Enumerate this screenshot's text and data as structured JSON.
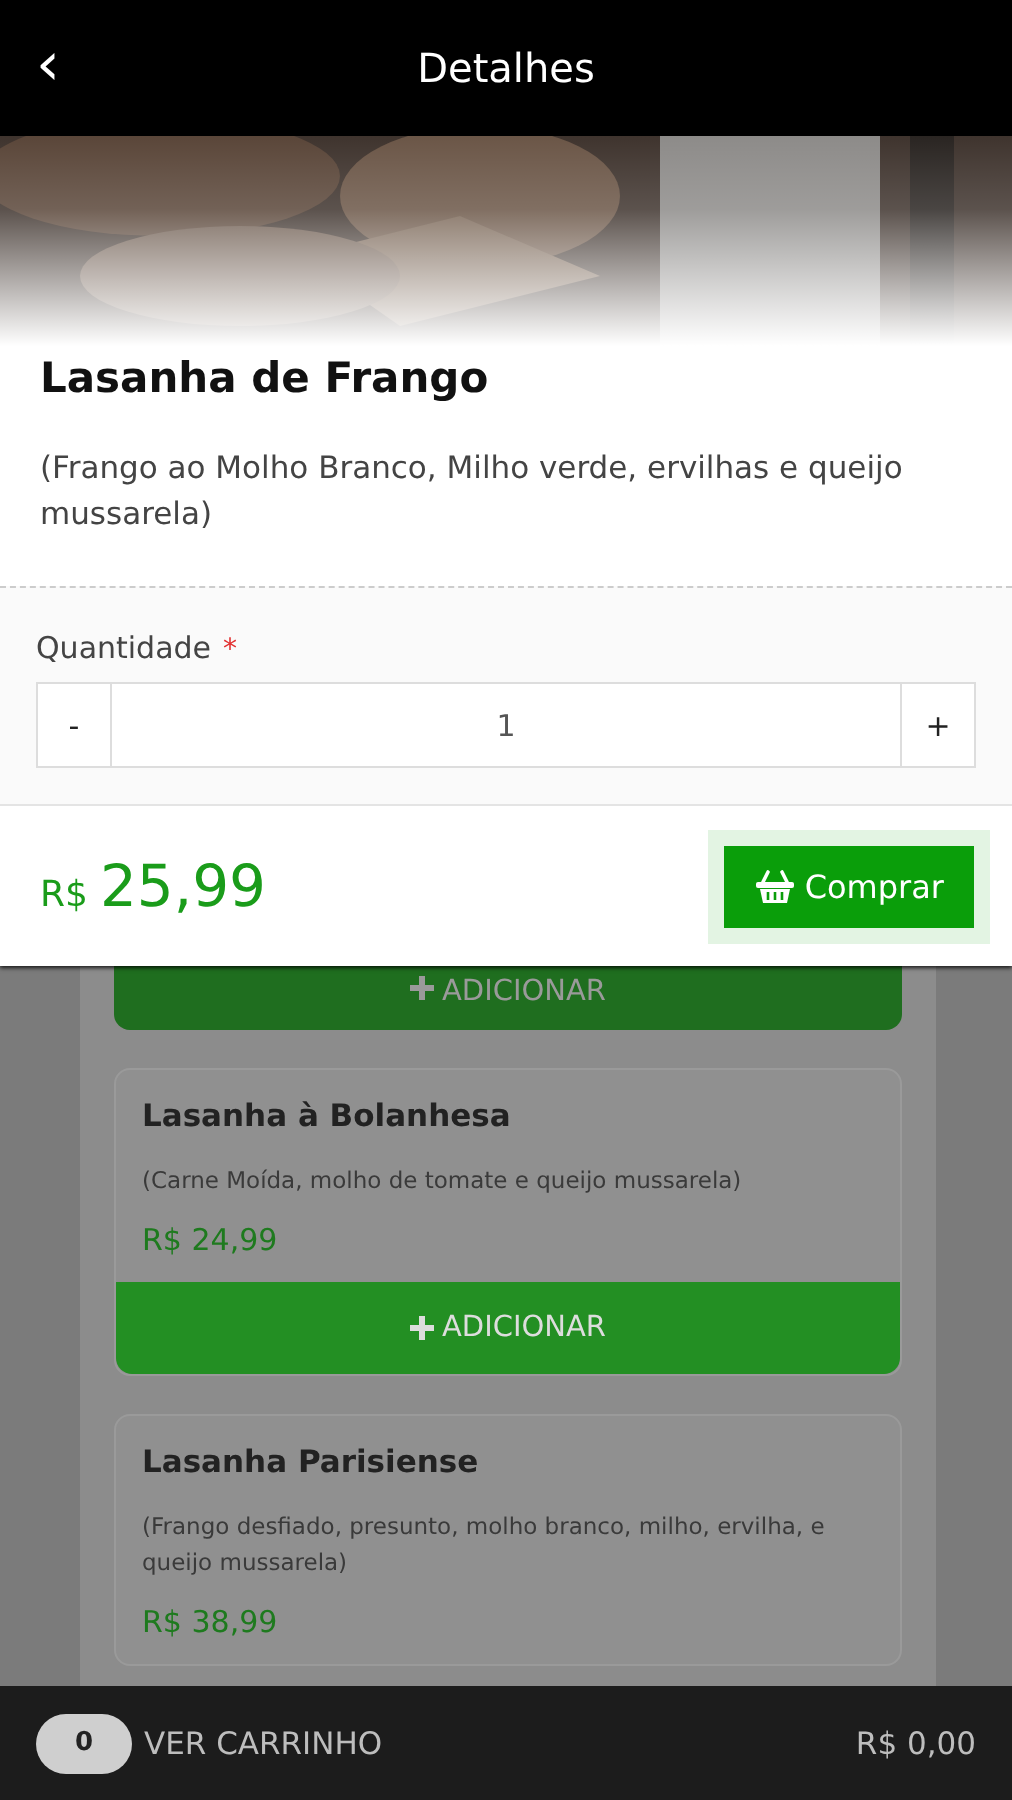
{
  "header": {
    "back": "‹",
    "title": "Detalhes"
  },
  "product": {
    "name": "Lasanha de Frango",
    "description": "(Frango ao Molho Branco, Milho verde, ervilhas e queijo mussarela)",
    "quantity_label": "Quantidade",
    "required_mark": "*",
    "quantity": {
      "minus": "-",
      "value": "1",
      "plus": "+"
    },
    "currency": "R$",
    "amount": "25,99",
    "buy_button": "Comprar"
  },
  "menu_items": [
    {
      "kind": "button_only",
      "button": "ADICIONAR"
    },
    {
      "kind": "card",
      "name": "Lasanha à Bolanhesa",
      "description": "(Carne Moída, molho de tomate e queijo mussarela)",
      "price": "R$ 24,99",
      "button": "ADICIONAR"
    },
    {
      "kind": "card",
      "name": "Lasanha Parisiense",
      "description": "(Frango desfiado, presunto, molho branco, milho, ervilha, e queijo mussarela)",
      "price": "R$ 38,99"
    }
  ],
  "cart_bar": {
    "count": "0",
    "label": "VER CARRINHO",
    "total": "R$ 0,00"
  }
}
